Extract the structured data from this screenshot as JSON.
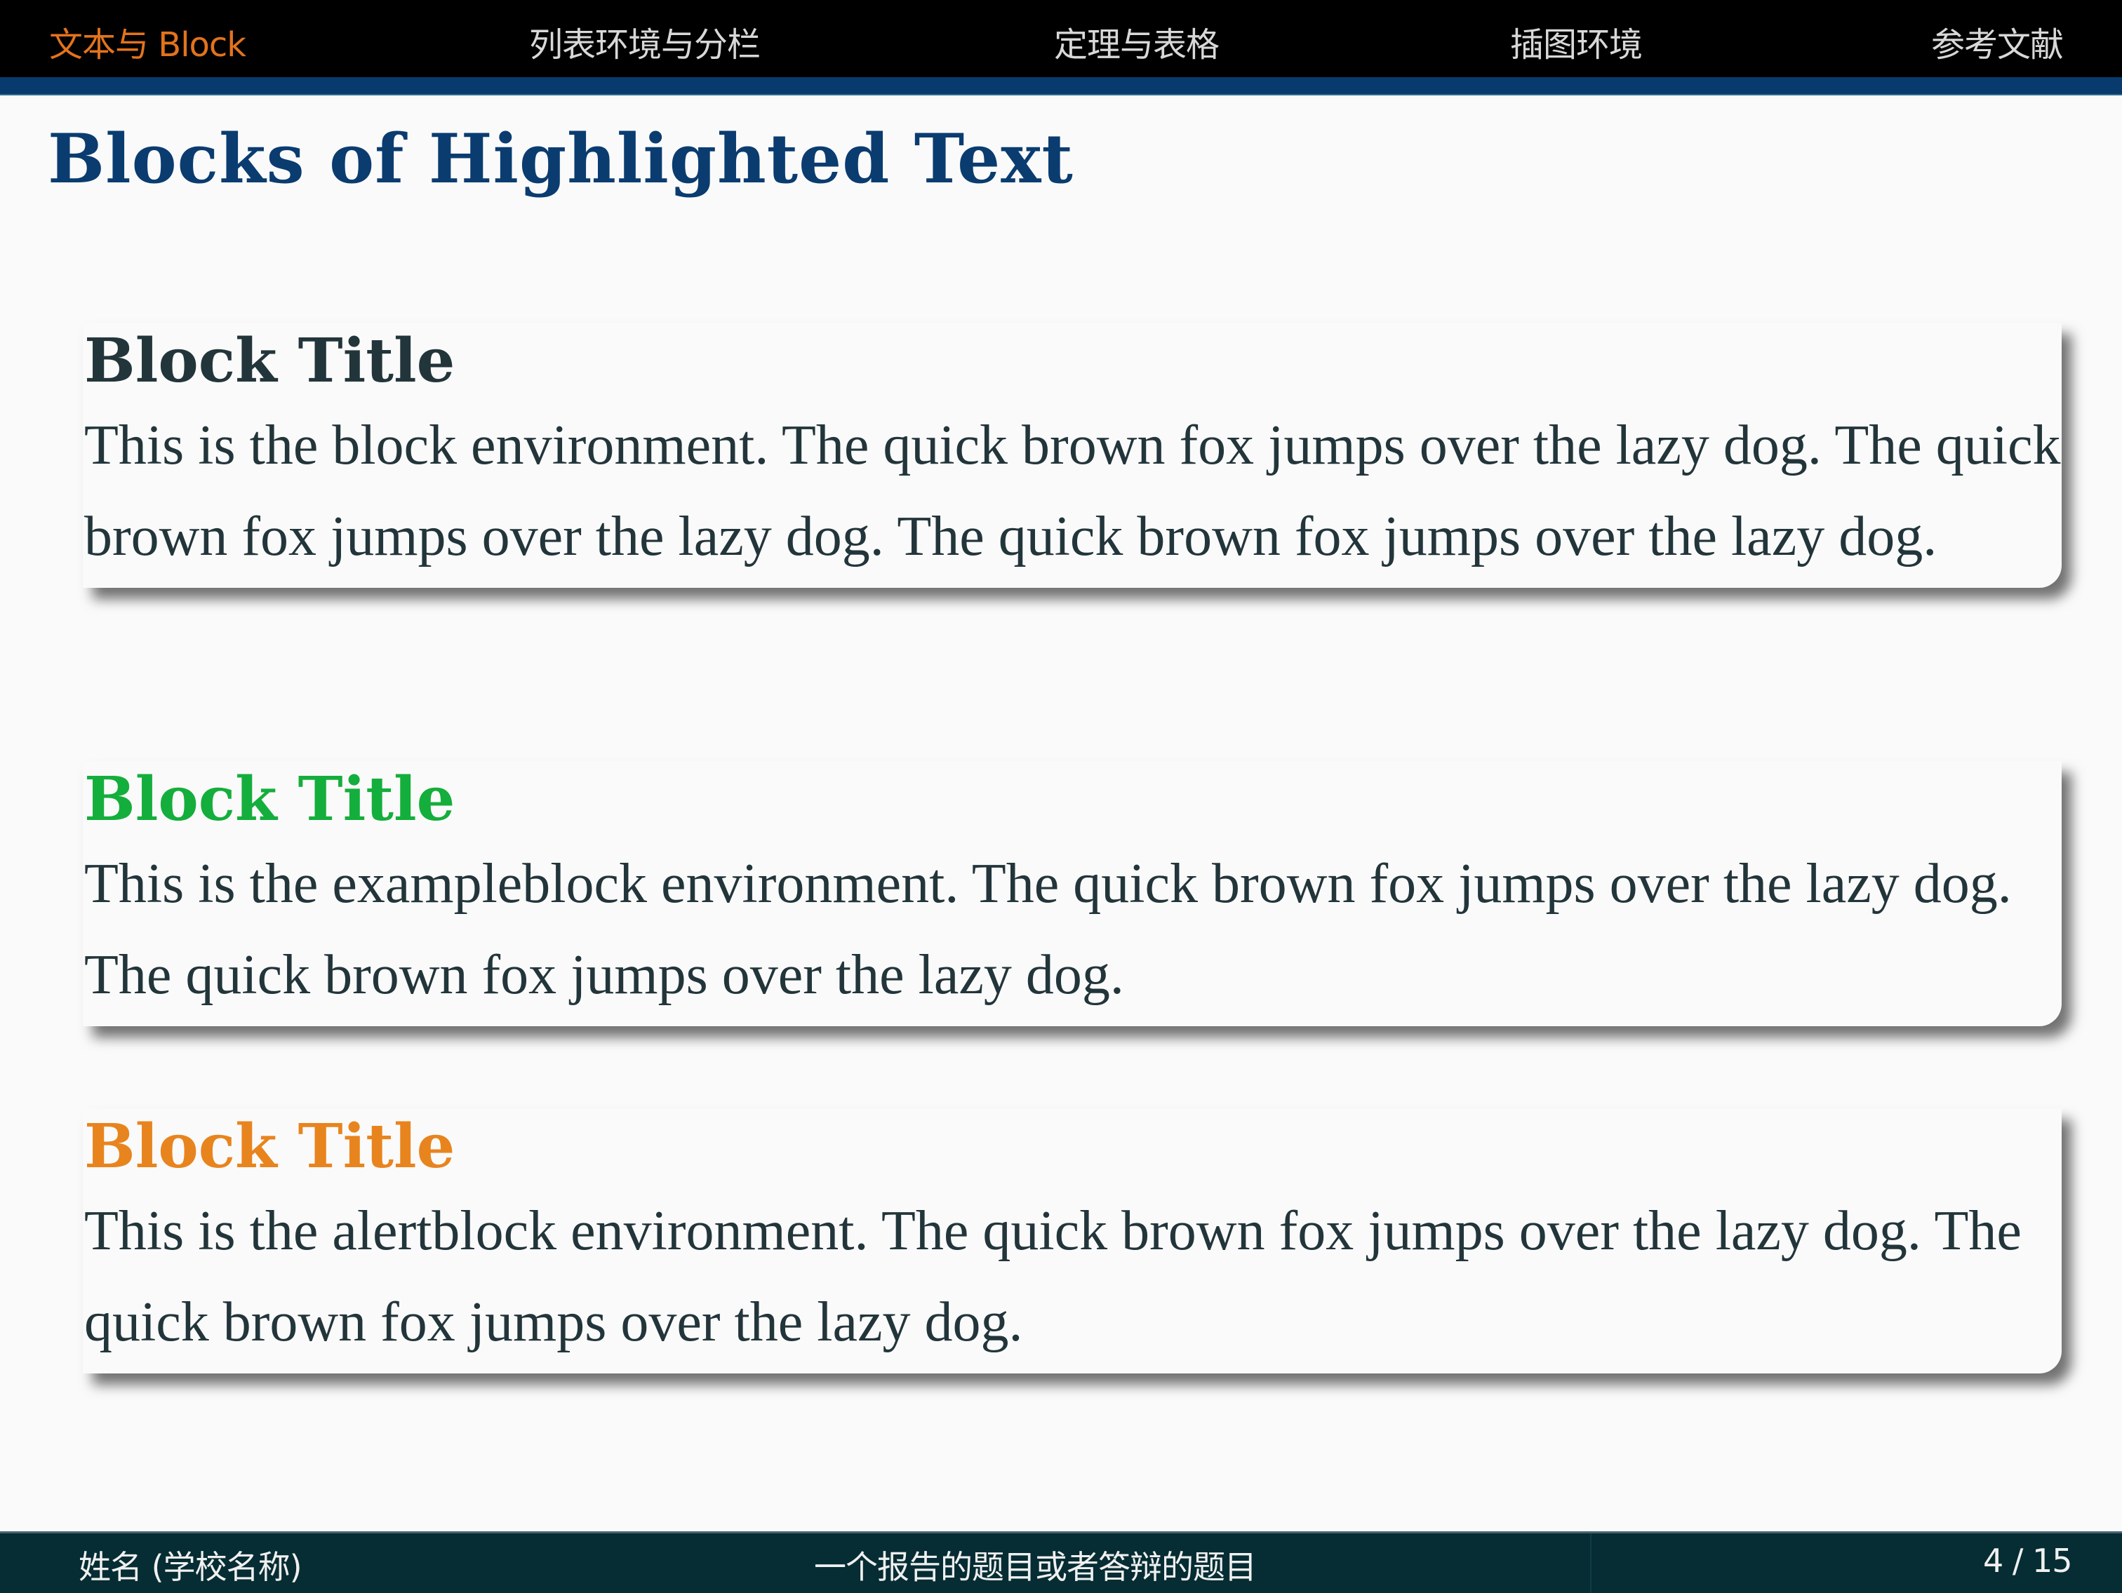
{
  "nav": {
    "items": [
      {
        "label": "文本与 Block",
        "active": true
      },
      {
        "label": "列表环境与分栏",
        "active": false
      },
      {
        "label": "定理与表格",
        "active": false
      },
      {
        "label": "插图环境",
        "active": false
      },
      {
        "label": "参考文献",
        "active": false
      }
    ]
  },
  "frame": {
    "title": "Blocks of Highlighted Text"
  },
  "blocks": [
    {
      "type": "block",
      "title": "Block Title",
      "body": "This is the block environment. The quick brown fox jumps over the lazy dog. The quick brown fox jumps over the lazy dog. The quick brown fox jumps over the lazy dog.",
      "title_color": "#22353a"
    },
    {
      "type": "exampleblock",
      "title": "Block Title",
      "body": "This is the exampleblock environment. The quick brown fox jumps over the lazy dog. The quick brown fox jumps over the lazy dog.",
      "title_color": "#14ae3c"
    },
    {
      "type": "alertblock",
      "title": "Block Title",
      "body": "This is the alertblock environment. The quick brown fox jumps over the lazy dog. The quick brown fox jumps over the lazy dog.",
      "title_color": "#e8841e"
    }
  ],
  "footer": {
    "author": "姓名 (学校名称)",
    "talk_title": "一个报告的题目或者答辩的题目",
    "page": "4 / 15"
  },
  "colors": {
    "nav_bg": "#000000",
    "nav_active": "#e3731c",
    "accent_blue": "#0a3c70",
    "footer_bg": "#052d33",
    "text": "#22353a"
  }
}
